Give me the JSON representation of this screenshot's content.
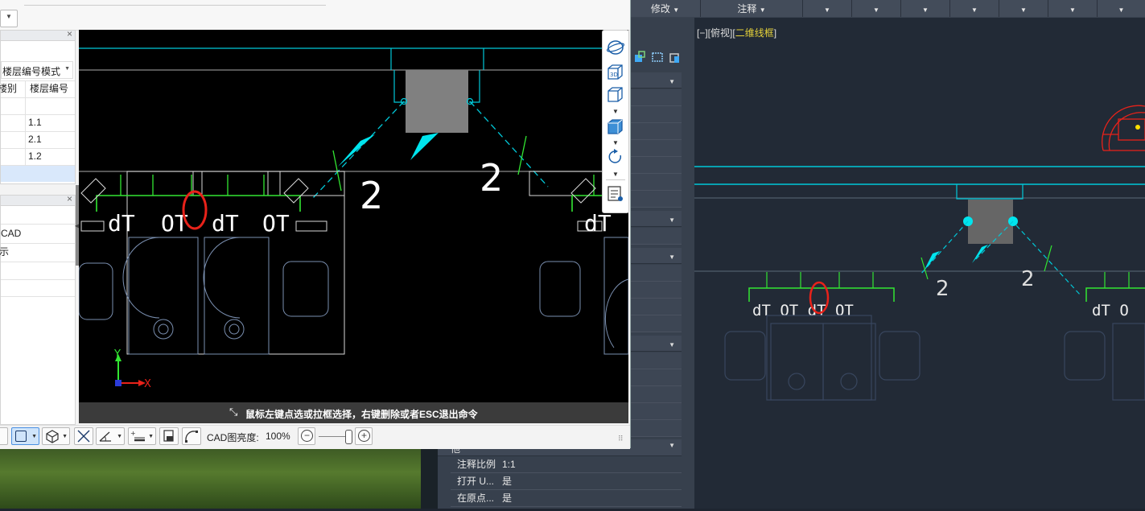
{
  "background_app": {
    "ribbon": {
      "tab_modify": "修改",
      "tab_annotate": "注释"
    },
    "view_label_prefix": "[−][俯视][",
    "view_label_style": "二维线框",
    "view_label_suffix": "]",
    "properties": [
      {
        "key": "注释比例",
        "value": "1:1"
      },
      {
        "key": "打开 U...",
        "value": "是"
      },
      {
        "key": "在原点...",
        "value": "是"
      }
    ],
    "section_tail": "其他"
  },
  "window": {
    "floor_mode_label": "楼层编号模式",
    "table": {
      "headers": [
        "楼别",
        "楼层编号"
      ],
      "rows": [
        {
          "c1": "",
          "c2": ""
        },
        {
          "c1": "",
          "c2": "1.1"
        },
        {
          "c1": "",
          "c2": "2.1"
        },
        {
          "c1": "",
          "c2": "1.2"
        },
        {
          "c1": "",
          "c2": ""
        }
      ]
    },
    "lower_panel": {
      "rows": [
        "CAD",
        "示",
        "",
        ""
      ]
    },
    "canvas": {
      "labels": [
        "dT",
        "OT",
        "dT",
        "OT",
        "dT"
      ],
      "dim_labels": [
        "2",
        "2"
      ],
      "axis_x": "X",
      "axis_y": "Y",
      "status_message": "鼠标左键点选或拉框选择，右键删除或者ESC退出命令"
    },
    "view_tools": {
      "icons": [
        "orbit-icon",
        "3d-view-icon",
        "front-cube-icon",
        "iso-cube-icon",
        "rotate-icon",
        "layer-list-icon"
      ]
    },
    "bottom_toolbar": {
      "brightness_label": "CAD图亮度:",
      "brightness_value": "100%",
      "brightness_level": 1.0
    }
  },
  "colors": {
    "cad_cyan": "#00e5ee",
    "cad_green": "#32e632",
    "cad_highlight": "#e8221a",
    "cad_gray_block": "#808080",
    "status_bg": "#3b3b3b"
  }
}
